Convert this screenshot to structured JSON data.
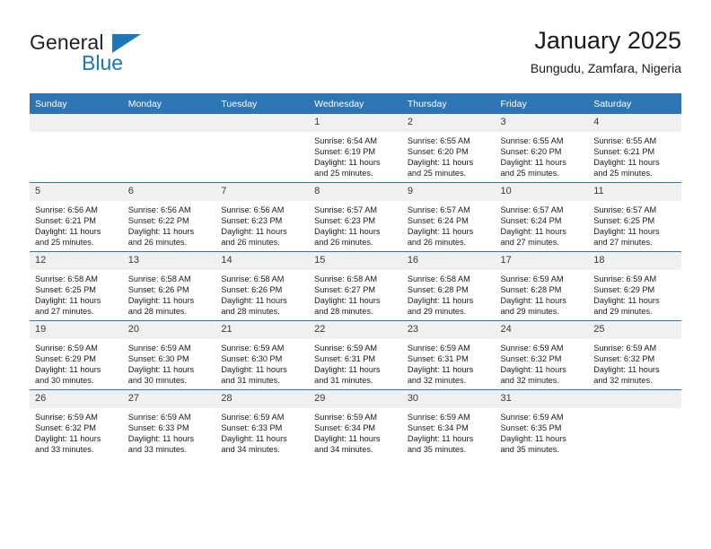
{
  "brand": {
    "name_part1": "General",
    "name_part2": "Blue",
    "triangle_color": "#1b76bc"
  },
  "header": {
    "title": "January 2025",
    "subtitle": "Bungudu, Zamfara, Nigeria"
  },
  "theme": {
    "header_blue": "#2e75b6",
    "daynum_bg": "#f0f0f0",
    "text": "#1a1a1a"
  },
  "weekdays": [
    "Sunday",
    "Monday",
    "Tuesday",
    "Wednesday",
    "Thursday",
    "Friday",
    "Saturday"
  ],
  "weeks": [
    [
      {
        "day": "",
        "lines": []
      },
      {
        "day": "",
        "lines": []
      },
      {
        "day": "",
        "lines": []
      },
      {
        "day": "1",
        "lines": [
          "Sunrise: 6:54 AM",
          "Sunset: 6:19 PM",
          "Daylight: 11 hours",
          "and 25 minutes."
        ]
      },
      {
        "day": "2",
        "lines": [
          "Sunrise: 6:55 AM",
          "Sunset: 6:20 PM",
          "Daylight: 11 hours",
          "and 25 minutes."
        ]
      },
      {
        "day": "3",
        "lines": [
          "Sunrise: 6:55 AM",
          "Sunset: 6:20 PM",
          "Daylight: 11 hours",
          "and 25 minutes."
        ]
      },
      {
        "day": "4",
        "lines": [
          "Sunrise: 6:55 AM",
          "Sunset: 6:21 PM",
          "Daylight: 11 hours",
          "and 25 minutes."
        ]
      }
    ],
    [
      {
        "day": "5",
        "lines": [
          "Sunrise: 6:56 AM",
          "Sunset: 6:21 PM",
          "Daylight: 11 hours",
          "and 25 minutes."
        ]
      },
      {
        "day": "6",
        "lines": [
          "Sunrise: 6:56 AM",
          "Sunset: 6:22 PM",
          "Daylight: 11 hours",
          "and 26 minutes."
        ]
      },
      {
        "day": "7",
        "lines": [
          "Sunrise: 6:56 AM",
          "Sunset: 6:23 PM",
          "Daylight: 11 hours",
          "and 26 minutes."
        ]
      },
      {
        "day": "8",
        "lines": [
          "Sunrise: 6:57 AM",
          "Sunset: 6:23 PM",
          "Daylight: 11 hours",
          "and 26 minutes."
        ]
      },
      {
        "day": "9",
        "lines": [
          "Sunrise: 6:57 AM",
          "Sunset: 6:24 PM",
          "Daylight: 11 hours",
          "and 26 minutes."
        ]
      },
      {
        "day": "10",
        "lines": [
          "Sunrise: 6:57 AM",
          "Sunset: 6:24 PM",
          "Daylight: 11 hours",
          "and 27 minutes."
        ]
      },
      {
        "day": "11",
        "lines": [
          "Sunrise: 6:57 AM",
          "Sunset: 6:25 PM",
          "Daylight: 11 hours",
          "and 27 minutes."
        ]
      }
    ],
    [
      {
        "day": "12",
        "lines": [
          "Sunrise: 6:58 AM",
          "Sunset: 6:25 PM",
          "Daylight: 11 hours",
          "and 27 minutes."
        ]
      },
      {
        "day": "13",
        "lines": [
          "Sunrise: 6:58 AM",
          "Sunset: 6:26 PM",
          "Daylight: 11 hours",
          "and 28 minutes."
        ]
      },
      {
        "day": "14",
        "lines": [
          "Sunrise: 6:58 AM",
          "Sunset: 6:26 PM",
          "Daylight: 11 hours",
          "and 28 minutes."
        ]
      },
      {
        "day": "15",
        "lines": [
          "Sunrise: 6:58 AM",
          "Sunset: 6:27 PM",
          "Daylight: 11 hours",
          "and 28 minutes."
        ]
      },
      {
        "day": "16",
        "lines": [
          "Sunrise: 6:58 AM",
          "Sunset: 6:28 PM",
          "Daylight: 11 hours",
          "and 29 minutes."
        ]
      },
      {
        "day": "17",
        "lines": [
          "Sunrise: 6:59 AM",
          "Sunset: 6:28 PM",
          "Daylight: 11 hours",
          "and 29 minutes."
        ]
      },
      {
        "day": "18",
        "lines": [
          "Sunrise: 6:59 AM",
          "Sunset: 6:29 PM",
          "Daylight: 11 hours",
          "and 29 minutes."
        ]
      }
    ],
    [
      {
        "day": "19",
        "lines": [
          "Sunrise: 6:59 AM",
          "Sunset: 6:29 PM",
          "Daylight: 11 hours",
          "and 30 minutes."
        ]
      },
      {
        "day": "20",
        "lines": [
          "Sunrise: 6:59 AM",
          "Sunset: 6:30 PM",
          "Daylight: 11 hours",
          "and 30 minutes."
        ]
      },
      {
        "day": "21",
        "lines": [
          "Sunrise: 6:59 AM",
          "Sunset: 6:30 PM",
          "Daylight: 11 hours",
          "and 31 minutes."
        ]
      },
      {
        "day": "22",
        "lines": [
          "Sunrise: 6:59 AM",
          "Sunset: 6:31 PM",
          "Daylight: 11 hours",
          "and 31 minutes."
        ]
      },
      {
        "day": "23",
        "lines": [
          "Sunrise: 6:59 AM",
          "Sunset: 6:31 PM",
          "Daylight: 11 hours",
          "and 32 minutes."
        ]
      },
      {
        "day": "24",
        "lines": [
          "Sunrise: 6:59 AM",
          "Sunset: 6:32 PM",
          "Daylight: 11 hours",
          "and 32 minutes."
        ]
      },
      {
        "day": "25",
        "lines": [
          "Sunrise: 6:59 AM",
          "Sunset: 6:32 PM",
          "Daylight: 11 hours",
          "and 32 minutes."
        ]
      }
    ],
    [
      {
        "day": "26",
        "lines": [
          "Sunrise: 6:59 AM",
          "Sunset: 6:32 PM",
          "Daylight: 11 hours",
          "and 33 minutes."
        ]
      },
      {
        "day": "27",
        "lines": [
          "Sunrise: 6:59 AM",
          "Sunset: 6:33 PM",
          "Daylight: 11 hours",
          "and 33 minutes."
        ]
      },
      {
        "day": "28",
        "lines": [
          "Sunrise: 6:59 AM",
          "Sunset: 6:33 PM",
          "Daylight: 11 hours",
          "and 34 minutes."
        ]
      },
      {
        "day": "29",
        "lines": [
          "Sunrise: 6:59 AM",
          "Sunset: 6:34 PM",
          "Daylight: 11 hours",
          "and 34 minutes."
        ]
      },
      {
        "day": "30",
        "lines": [
          "Sunrise: 6:59 AM",
          "Sunset: 6:34 PM",
          "Daylight: 11 hours",
          "and 35 minutes."
        ]
      },
      {
        "day": "31",
        "lines": [
          "Sunrise: 6:59 AM",
          "Sunset: 6:35 PM",
          "Daylight: 11 hours",
          "and 35 minutes."
        ]
      },
      {
        "day": "",
        "lines": []
      }
    ]
  ]
}
